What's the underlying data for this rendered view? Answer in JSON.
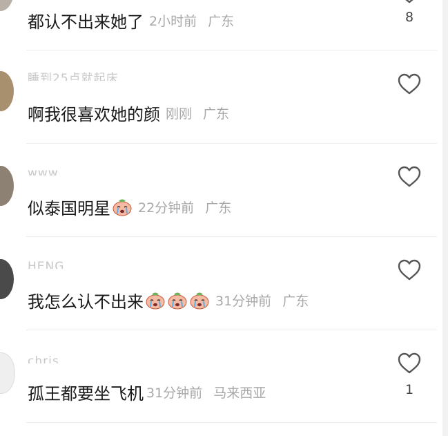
{
  "comments": [
    {
      "username": "",
      "text": "都认不出来她了",
      "time": "2小时前",
      "location": "广东",
      "likes": "8",
      "emoji_count": 0,
      "avatar_color": "#b9b1a8"
    },
    {
      "username": "睡到25点就起床",
      "text": "啊我很喜欢她的颜",
      "time": "刚刚",
      "location": "广东",
      "likes": "",
      "emoji_count": 0,
      "avatar_color": "#a88f6e"
    },
    {
      "username": "www",
      "text": "似泰国明星",
      "time": "22分钟前",
      "location": "广东",
      "likes": "",
      "emoji_count": 1,
      "avatar_color": "#8d8174"
    },
    {
      "username": "HENG",
      "text": "我怎么认不出来",
      "time": "31分钟前",
      "location": "广东",
      "likes": "",
      "emoji_count": 3,
      "avatar_color": "#4a4a4a"
    },
    {
      "username": "chris",
      "text": "孤王都要坐飞机",
      "time": "31分钟前",
      "location": "马来西亚",
      "likes": "1",
      "emoji_count": 0,
      "avatar_color": "#efefef"
    }
  ],
  "icons": {
    "like": "heart-outline-icon",
    "emoji": "crying-peach-emoji"
  },
  "colors": {
    "text": "#1a1a1a",
    "meta": "#a8a8a8",
    "icon": "#555555",
    "divider": "#ececec"
  }
}
